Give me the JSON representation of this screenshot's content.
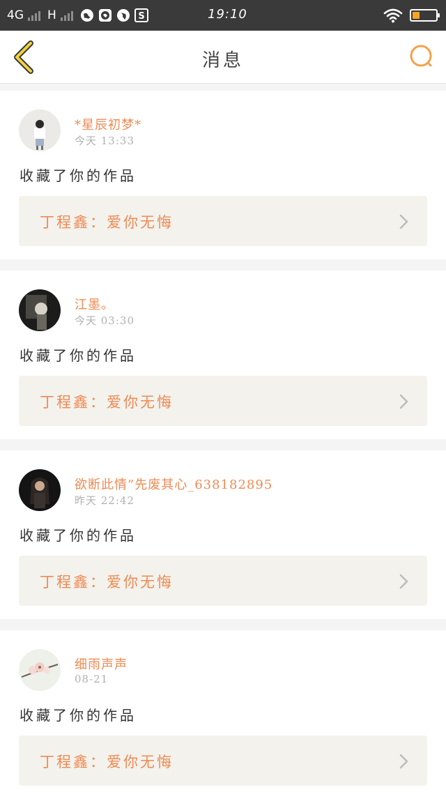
{
  "status_bar": {
    "network": "4G",
    "network2": "H",
    "time": "19:10",
    "battery_level": 0.3,
    "battery_color": "#f5a623"
  },
  "header": {
    "title": "消息",
    "back_icon": "chevron-left-icon",
    "search_icon": "search-icon",
    "accent_color": "#f4a24a"
  },
  "messages": [
    {
      "user": "*星辰初梦*",
      "time": "今天 13:33",
      "action": "收藏了你的作品",
      "work": "丁程鑫：爱你无悔"
    },
    {
      "user": "江墨。",
      "time": "今天 03:30",
      "action": "收藏了你的作品",
      "work": "丁程鑫：爱你无悔"
    },
    {
      "user": "欲断此情”先废其心_638182895",
      "time": "昨天 22:42",
      "action": "收藏了你的作品",
      "work": "丁程鑫：爱你无悔"
    },
    {
      "user": "细雨声声",
      "time": "08-21",
      "action": "收藏了你的作品",
      "work": "丁程鑫：爱你无悔"
    }
  ],
  "colors": {
    "username": "#ef8a53",
    "link_card_bg": "#f3f2ed"
  }
}
